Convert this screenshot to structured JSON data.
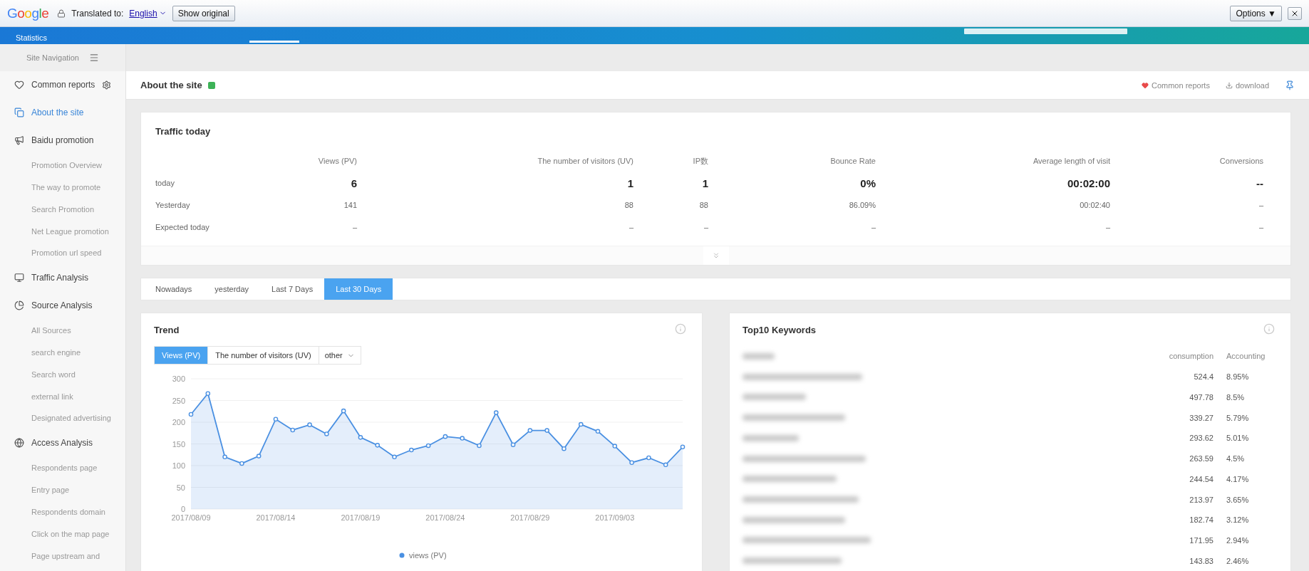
{
  "translate_bar": {
    "logo": "Google",
    "label": "Translated to:",
    "language": "English",
    "show_original": "Show original",
    "options": "Options ▼"
  },
  "header": {
    "title": "Statistics"
  },
  "sidebar": {
    "nav_label": "Site Navigation",
    "items": [
      {
        "label": "Common reports",
        "kind": "group",
        "selected": false,
        "has_settings": true
      },
      {
        "label": "About the site",
        "kind": "group",
        "selected": true
      },
      {
        "label": "Baidu promotion",
        "kind": "group",
        "selected": false
      },
      {
        "label": "Promotion Overview",
        "kind": "sub",
        "selected": false
      },
      {
        "label": "The way to promote",
        "kind": "sub",
        "selected": false
      },
      {
        "label": "Search Promotion",
        "kind": "sub",
        "selected": false
      },
      {
        "label": "Net League promotion",
        "kind": "sub",
        "selected": false
      },
      {
        "label": "Promotion url speed",
        "kind": "sub",
        "selected": false
      },
      {
        "label": "Traffic Analysis",
        "kind": "group",
        "selected": false
      },
      {
        "label": "Source Analysis",
        "kind": "group",
        "selected": false
      },
      {
        "label": "All Sources",
        "kind": "sub",
        "selected": false
      },
      {
        "label": "search engine",
        "kind": "sub",
        "selected": false
      },
      {
        "label": "Search word",
        "kind": "sub",
        "selected": false
      },
      {
        "label": "external link",
        "kind": "sub",
        "selected": false
      },
      {
        "label": "Designated advertising",
        "kind": "sub",
        "selected": false
      },
      {
        "label": "Access Analysis",
        "kind": "group",
        "selected": false
      },
      {
        "label": "Respondents page",
        "kind": "sub",
        "selected": false
      },
      {
        "label": "Entry page",
        "kind": "sub",
        "selected": false
      },
      {
        "label": "Respondents domain",
        "kind": "sub",
        "selected": false
      },
      {
        "label": "Click on the map page",
        "kind": "sub",
        "selected": false
      },
      {
        "label": "Page upstream and",
        "kind": "sub",
        "selected": false
      }
    ]
  },
  "page_header": {
    "title": "About the site",
    "common_reports": "Common reports",
    "download": "download"
  },
  "traffic_today": {
    "title": "Traffic today",
    "columns": [
      "Views (PV)",
      "The number of visitors (UV)",
      "IP数",
      "Bounce Rate",
      "Average length of visit",
      "Conversions"
    ],
    "rows": [
      {
        "label": "today",
        "emphasis": true,
        "values": [
          "6",
          "1",
          "1",
          "0%",
          "00:02:00",
          "--"
        ]
      },
      {
        "label": "Yesterday",
        "emphasis": false,
        "values": [
          "141",
          "88",
          "88",
          "86.09%",
          "00:02:40",
          "–"
        ]
      },
      {
        "label": "Expected today",
        "emphasis": false,
        "values": [
          "–",
          "–",
          "–",
          "–",
          "–",
          "–"
        ]
      }
    ]
  },
  "period_tabs": [
    {
      "label": "Nowadays",
      "selected": false
    },
    {
      "label": "yesterday",
      "selected": false
    },
    {
      "label": "Last 7 Days",
      "selected": false
    },
    {
      "label": "Last 30 Days",
      "selected": true
    }
  ],
  "trend": {
    "title": "Trend",
    "metric_tabs": [
      {
        "label": "Views (PV)",
        "selected": true
      },
      {
        "label": "The number of visitors (UV)",
        "selected": false
      }
    ],
    "other": "other",
    "chart_data": {
      "type": "area",
      "grid": true,
      "categories": [
        "2017/08/09",
        null,
        null,
        null,
        null,
        "2017/08/14",
        null,
        null,
        null,
        null,
        "2017/08/19",
        null,
        null,
        null,
        null,
        "2017/08/24",
        null,
        null,
        null,
        null,
        "2017/08/29",
        null,
        null,
        null,
        null,
        "2017/09/03",
        null,
        null,
        null,
        null
      ],
      "series": [
        {
          "name": "views (PV)",
          "color": "#4a90e2",
          "values": [
            218,
            266,
            120,
            105,
            122,
            207,
            182,
            194,
            173,
            226,
            165,
            147,
            120,
            136,
            146,
            167,
            163,
            146,
            222,
            148,
            181,
            181,
            139,
            195,
            179,
            145,
            107,
            118,
            102,
            143
          ]
        }
      ],
      "ylim": [
        0,
        300
      ],
      "yticks": [
        0,
        50,
        100,
        150,
        200,
        250,
        300
      ]
    }
  },
  "keywords": {
    "title": "Top10 Keywords",
    "columns": [
      "consumption",
      "Accounting"
    ],
    "rows": [
      {
        "consumption": "524.4",
        "accounting": "8.95%"
      },
      {
        "consumption": "497.78",
        "accounting": "8.5%"
      },
      {
        "consumption": "339.27",
        "accounting": "5.79%"
      },
      {
        "consumption": "293.62",
        "accounting": "5.01%"
      },
      {
        "consumption": "263.59",
        "accounting": "4.5%"
      },
      {
        "consumption": "244.54",
        "accounting": "4.17%"
      },
      {
        "consumption": "213.97",
        "accounting": "3.65%"
      },
      {
        "consumption": "182.74",
        "accounting": "3.12%"
      },
      {
        "consumption": "171.95",
        "accounting": "2.94%"
      },
      {
        "consumption": "143.83",
        "accounting": "2.46%"
      }
    ]
  }
}
